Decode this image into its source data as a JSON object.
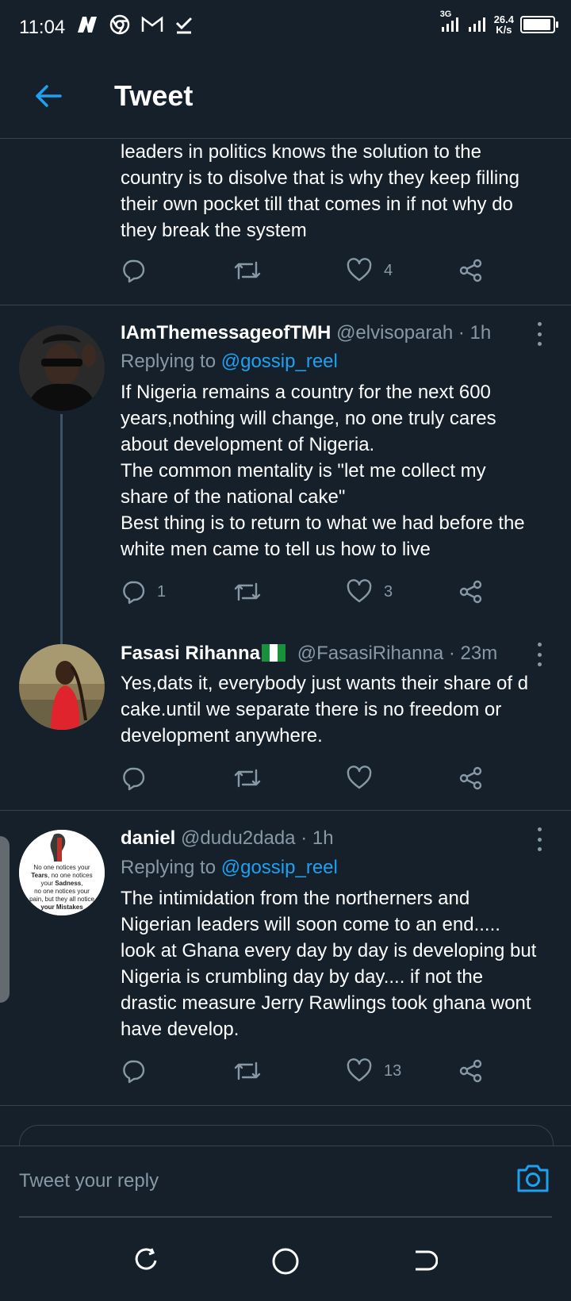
{
  "status_bar": {
    "time": "11:04",
    "network_type": "3G",
    "speed_value": "26.4",
    "speed_unit": "K/s",
    "icons_left": [
      "n-app-icon",
      "chrome-icon",
      "gmail-icon",
      "download-done-icon"
    ],
    "icons_right": [
      "signal-icon",
      "signal-icon",
      "battery-icon"
    ]
  },
  "header": {
    "title": "Tweet",
    "back_icon": "arrow-left-icon"
  },
  "colors": {
    "background": "#15202b",
    "accent": "#1da1f2",
    "muted": "#8899a6",
    "divider": "#38444d"
  },
  "tweets": [
    {
      "text": "leaders in politics knows the solution to the\ncountry is to disolve that is why they keep filling\ntheir own pocket till that comes in if not why do\nthey break the system",
      "reply_count": "",
      "retweet_count": "",
      "like_count": "4"
    },
    {
      "name": "IAmThemessageofTMH",
      "handle": "@elvisoparah",
      "time": "· 1h",
      "replying_label": "Replying to",
      "replying_to": "@gossip_reel",
      "text": "If Nigeria remains a country for the next 600\nyears,nothing will change, no one truly cares\nabout development of Nigeria.\nThe common mentality is \"let me collect my\nshare of the national cake\"\nBest thing is to return to what we had before the\nwhite men came to tell us how to live",
      "reply_count": "1",
      "retweet_count": "",
      "like_count": "3"
    },
    {
      "name": "Fasasi Rihanna",
      "handle": "@FasasiRihanna",
      "time": "· 23m",
      "flag": "nigeria-flag-icon",
      "text": "Yes,dats it, everybody just wants their share of d\ncake.until we separate there is no freedom or\ndevelopment anywhere.",
      "reply_count": "",
      "retweet_count": "",
      "like_count": ""
    },
    {
      "name": "daniel",
      "handle": "@dudu2dada",
      "time": "· 1h",
      "replying_label": "Replying to",
      "replying_to": "@gossip_reel",
      "avatar_text": "No one notices your Tears, no one notices your Sadness, no one notices your pain, but they all notice your Mistakes",
      "text": "The intimidation from the northerners and\nNigerian leaders will soon come to an end.....\nlook at Ghana every day by day is developing but\nNigeria is crumbling day by day.... if not the\ndrastic measure Jerry Rawlings took ghana wont\nhave develop.",
      "reply_count": "",
      "retweet_count": "",
      "like_count": "13"
    }
  ],
  "compose": {
    "placeholder": "Tweet your reply",
    "camera_icon": "camera-icon"
  },
  "nav": {
    "icons": [
      "recents-icon",
      "home-icon",
      "back-icon"
    ]
  }
}
